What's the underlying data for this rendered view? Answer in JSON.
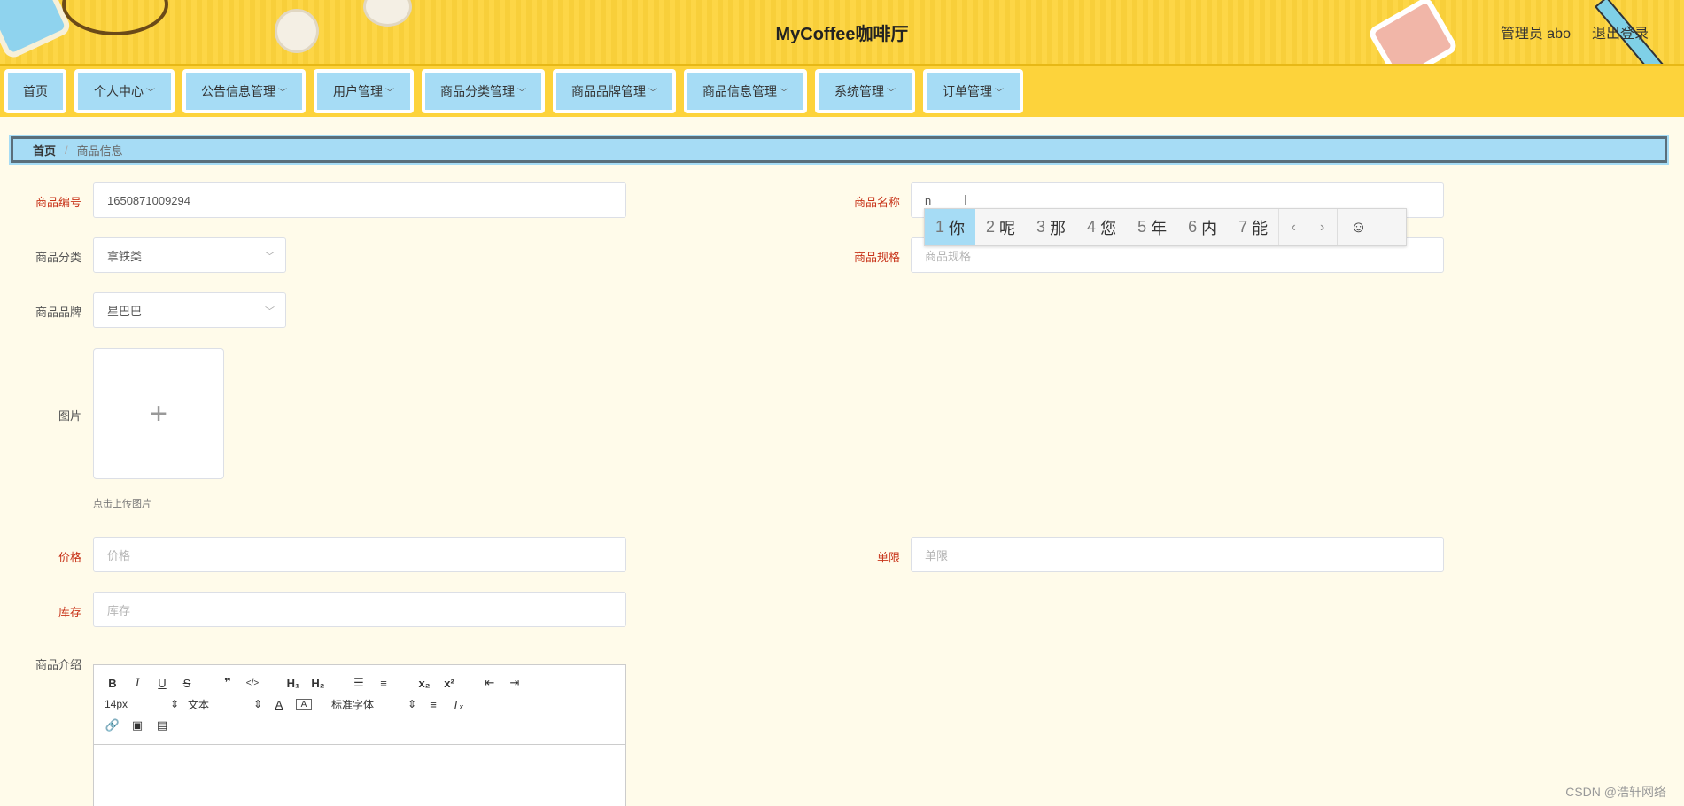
{
  "header": {
    "title": "MyCoffee咖啡厅",
    "user_label": "管理员 abo",
    "logout_label": "退出登录"
  },
  "nav": [
    {
      "label": "首页",
      "dropdown": false
    },
    {
      "label": "个人中心",
      "dropdown": true
    },
    {
      "label": "公告信息管理",
      "dropdown": true
    },
    {
      "label": "用户管理",
      "dropdown": true
    },
    {
      "label": "商品分类管理",
      "dropdown": true
    },
    {
      "label": "商品品牌管理",
      "dropdown": true
    },
    {
      "label": "商品信息管理",
      "dropdown": true
    },
    {
      "label": "系统管理",
      "dropdown": true
    },
    {
      "label": "订单管理",
      "dropdown": true
    }
  ],
  "breadcrumb": {
    "home": "首页",
    "separator": "/",
    "current": "商品信息"
  },
  "form": {
    "code_label": "商品编号",
    "code_value": "1650871009294",
    "name_label": "商品名称",
    "name_value": "n",
    "category_label": "商品分类",
    "category_value": "拿铁类",
    "spec_label": "商品规格",
    "spec_placeholder": "商品规格",
    "brand_label": "商品品牌",
    "brand_value": "星巴巴",
    "image_label": "图片",
    "upload_tip": "点击上传图片",
    "price_label": "价格",
    "price_placeholder": "价格",
    "limit_label": "单限",
    "limit_placeholder": "单限",
    "stock_label": "库存",
    "stock_placeholder": "库存",
    "intro_label": "商品介绍"
  },
  "ime": {
    "candidates": [
      {
        "num": "1",
        "text": "你"
      },
      {
        "num": "2",
        "text": "呢"
      },
      {
        "num": "3",
        "text": "那"
      },
      {
        "num": "4",
        "text": "您"
      },
      {
        "num": "5",
        "text": "年"
      },
      {
        "num": "6",
        "text": "内"
      },
      {
        "num": "7",
        "text": "能"
      }
    ],
    "prev": "‹",
    "next": "›",
    "emoji": "☺"
  },
  "editor": {
    "font_size": "14px",
    "text_type": "文本",
    "font_family": "标准字体"
  },
  "watermark": "CSDN @浩轩网络"
}
